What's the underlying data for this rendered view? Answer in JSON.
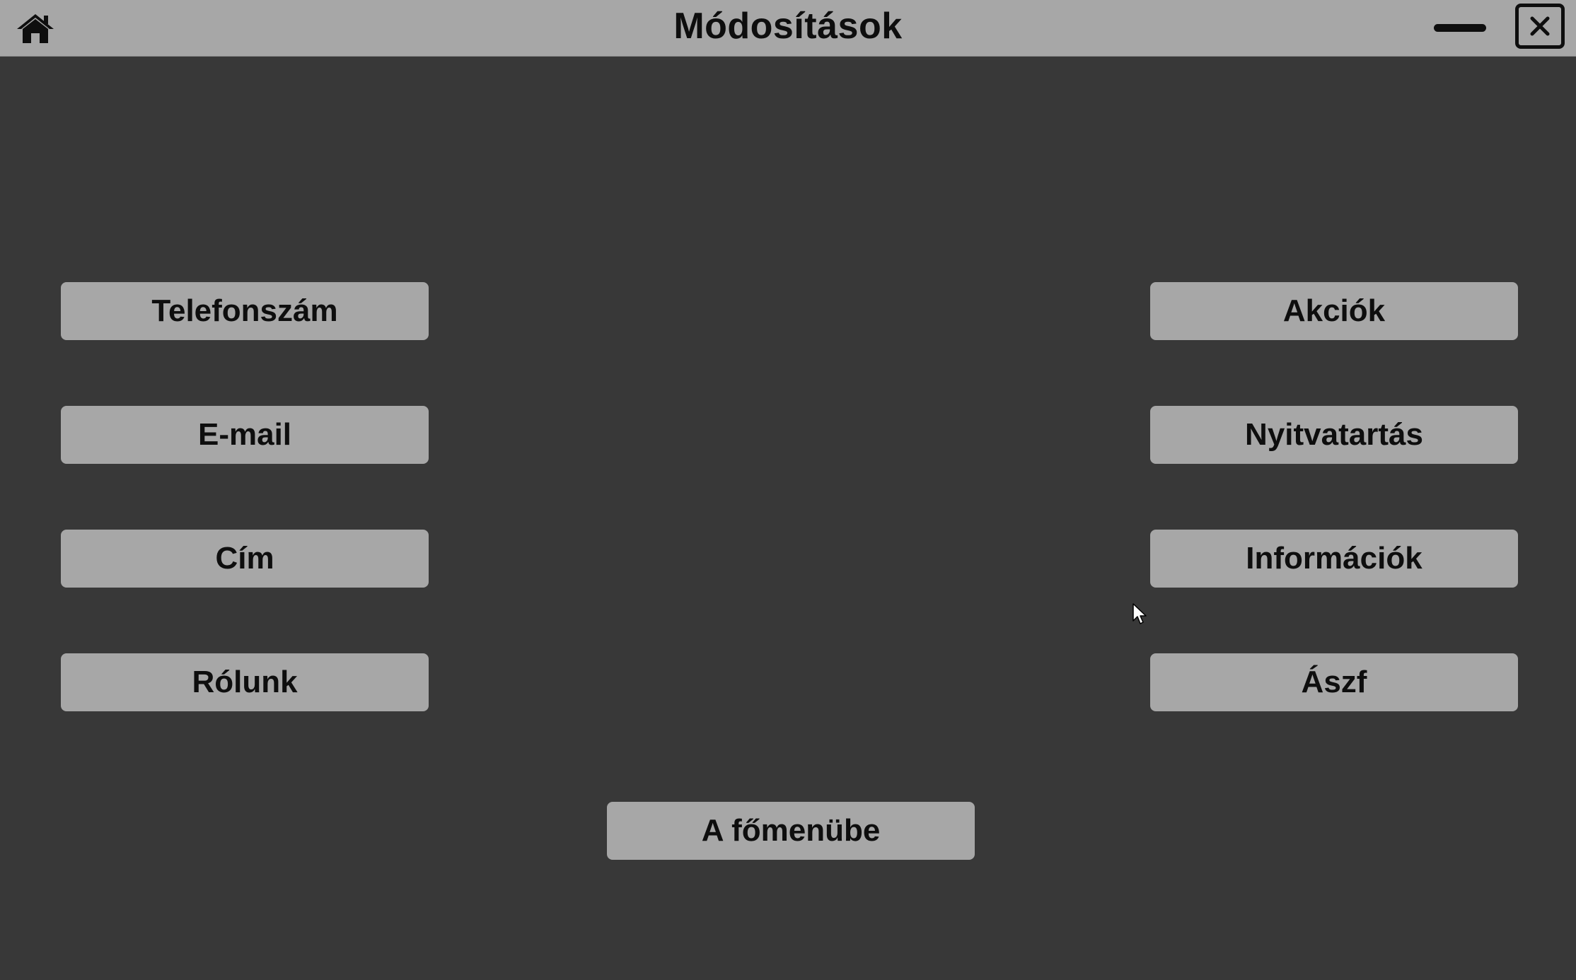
{
  "window": {
    "title": "Módosítások",
    "icons": {
      "home": "home-icon",
      "minimize": "minimize-icon",
      "close": "close-icon"
    }
  },
  "buttons": {
    "left": [
      {
        "label": "Telefonszám"
      },
      {
        "label": "E-mail"
      },
      {
        "label": "Cím"
      },
      {
        "label": "Rólunk"
      }
    ],
    "right": [
      {
        "label": "Akciók"
      },
      {
        "label": "Nyitvatartás"
      },
      {
        "label": "Információk"
      },
      {
        "label": "Ászf"
      }
    ],
    "main_menu": {
      "label": "A főmenübe"
    }
  },
  "colors": {
    "background": "#383838",
    "titlebar": "#a7a7a7",
    "button": "#a7a7a7",
    "text": "#0e0e0e"
  }
}
